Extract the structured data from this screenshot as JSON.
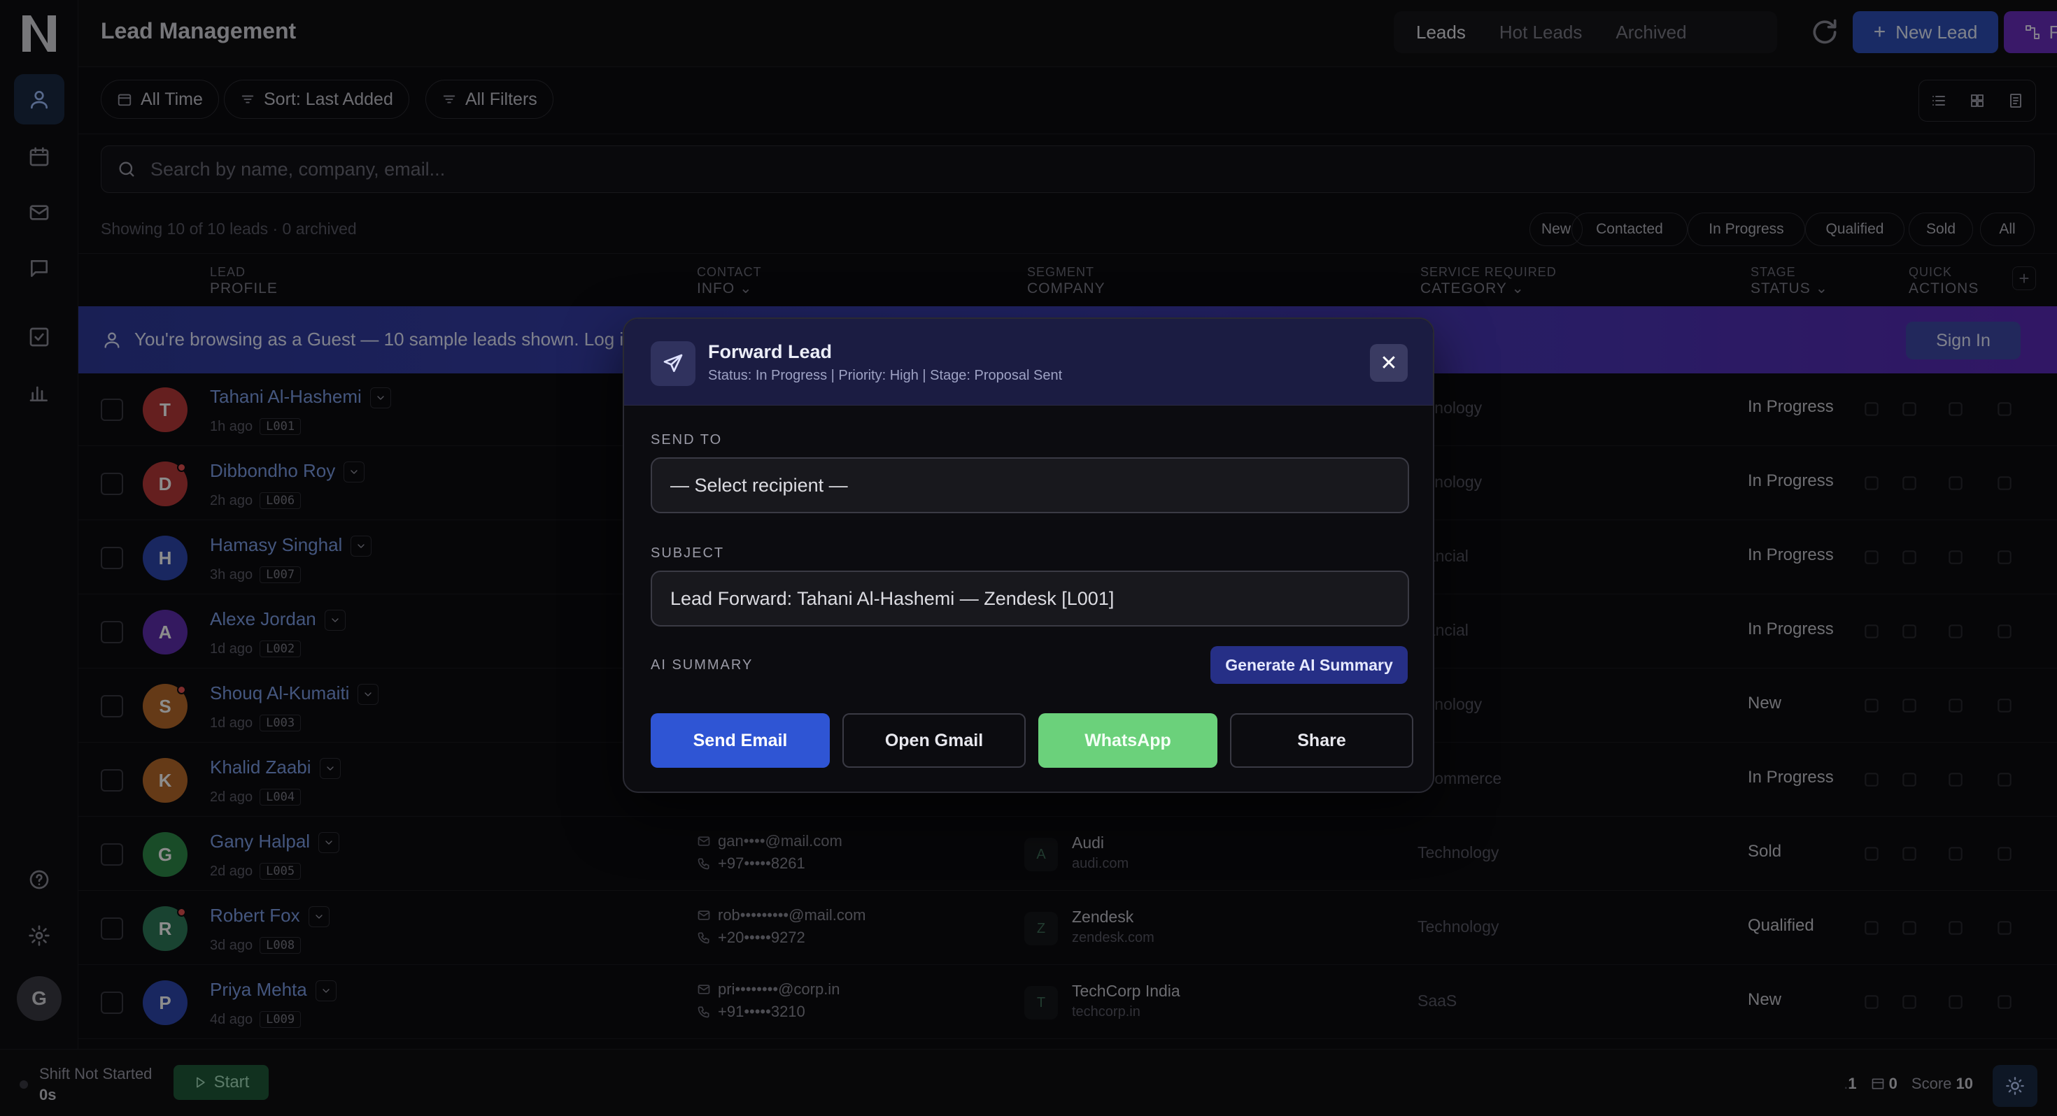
{
  "header": {
    "title": "Lead Management",
    "tabs": [
      {
        "label": "Leads",
        "active": true
      },
      {
        "label": "Hot Leads",
        "active": false
      },
      {
        "label": "Archived",
        "active": false
      }
    ],
    "new_lead_label": "New Lead",
    "flow_label": "Flow"
  },
  "toolbar": {
    "time_filter": "All Time",
    "sort": "Sort: Last Added",
    "filters": "All Filters"
  },
  "search": {
    "placeholder": "Search by name, company, email..."
  },
  "summary": {
    "showing": "Showing 10 of 10 leads · 0 archived",
    "stage_chips": [
      "New",
      "Contacted",
      "In Progress",
      "Qualified",
      "Sold",
      "All"
    ]
  },
  "table": {
    "columns": [
      {
        "top": "LEAD",
        "sub": "PROFILE"
      },
      {
        "top": "CONTACT",
        "sub": "INFO"
      },
      {
        "top": "SEGMENT",
        "sub": "COMPANY"
      },
      {
        "top": "SERVICE REQUIRED",
        "sub": "CATEGORY"
      },
      {
        "top": "STAGE",
        "sub": "STATUS"
      },
      {
        "top": "QUICK",
        "sub": "ACTIONS"
      }
    ],
    "rows": [
      {
        "initial": "T",
        "name": "Tahani Al-Hashemi",
        "age": "1h ago",
        "id": "L001",
        "category": "chnology",
        "status": "In Progress",
        "avatar_color": "#b83a3a",
        "dot": false
      },
      {
        "initial": "D",
        "name": "Dibbondho Roy",
        "age": "2h ago",
        "id": "L006",
        "category": "chnology",
        "status": "In Progress",
        "avatar_color": "#b83a3a",
        "dot": true
      },
      {
        "initial": "H",
        "name": "Hamasy Singhal",
        "age": "3h ago",
        "id": "L007",
        "category": "nancial",
        "status": "In Progress",
        "avatar_color": "#2f47b0",
        "dot": false
      },
      {
        "initial": "A",
        "name": "Alexe Jordan",
        "age": "1d ago",
        "id": "L002",
        "category": "nancial",
        "status": "In Progress",
        "avatar_color": "#5f2fb0",
        "dot": false
      },
      {
        "initial": "S",
        "name": "Shouq Al-Kumaiti",
        "age": "1d ago",
        "id": "L003",
        "category": "chnology",
        "status": "New",
        "avatar_color": "#b86a2a",
        "dot": true
      },
      {
        "initial": "K",
        "name": "Khalid Zaabi",
        "age": "2d ago",
        "id": "L004",
        "category": "-Commerce",
        "status": "In Progress",
        "avatar_color": "#b86a2a",
        "dot": false
      },
      {
        "initial": "G",
        "name": "Gany Halpal",
        "age": "2d ago",
        "id": "L005",
        "email": "gan••••@mail.com",
        "phone": "+97•••••8261",
        "company_initial": "A",
        "company": "Audi",
        "domain": "audi.com",
        "category": "Technology",
        "status": "Sold",
        "avatar_color": "#2f8a4a",
        "dot": false
      },
      {
        "initial": "R",
        "name": "Robert Fox",
        "age": "3d ago",
        "id": "L008",
        "email": "rob•••••••••@mail.com",
        "phone": "+20•••••9272",
        "company_initial": "Z",
        "company": "Zendesk",
        "domain": "zendesk.com",
        "category": "Technology",
        "status": "Qualified",
        "avatar_color": "#2f7a5a",
        "dot": true
      },
      {
        "initial": "P",
        "name": "Priya Mehta",
        "age": "4d ago",
        "id": "L009",
        "email": "pri••••••••@corp.in",
        "phone": "+91•••••3210",
        "company_initial": "T",
        "company": "TechCorp India",
        "domain": "techcorp.in",
        "category": "SaaS",
        "status": "New",
        "avatar_color": "#2f47b0",
        "dot": false
      }
    ]
  },
  "banner": {
    "text": "You're browsing as a Guest — 10 sample leads shown. Log in t",
    "signin_label": "Sign In"
  },
  "modal": {
    "title": "Forward Lead",
    "subtitle": "Status: In Progress | Priority: High | Stage: Proposal Sent",
    "send_to_label": "SEND TO",
    "recipient_value": "— Select recipient —",
    "subject_label": "SUBJECT",
    "subject_value": "Lead Forward: Tahani Al-Hashemi — Zendesk [L001]",
    "ai_summary_label": "AI SUMMARY",
    "generate_label": "Generate AI Summary",
    "actions": {
      "send_email": "Send Email",
      "open_gmail": "Open Gmail",
      "whatsapp": "WhatsApp",
      "share": "Share"
    },
    "colors": {
      "send": "#2f55d4",
      "whatsapp": "#6bd17b"
    }
  },
  "footer": {
    "shift_label": "Shift Not Started",
    "shift_time": "0s",
    "start_label": "Start",
    "count_a": "1",
    "count_b": "0",
    "score_label": "Score",
    "score_value": "10"
  }
}
